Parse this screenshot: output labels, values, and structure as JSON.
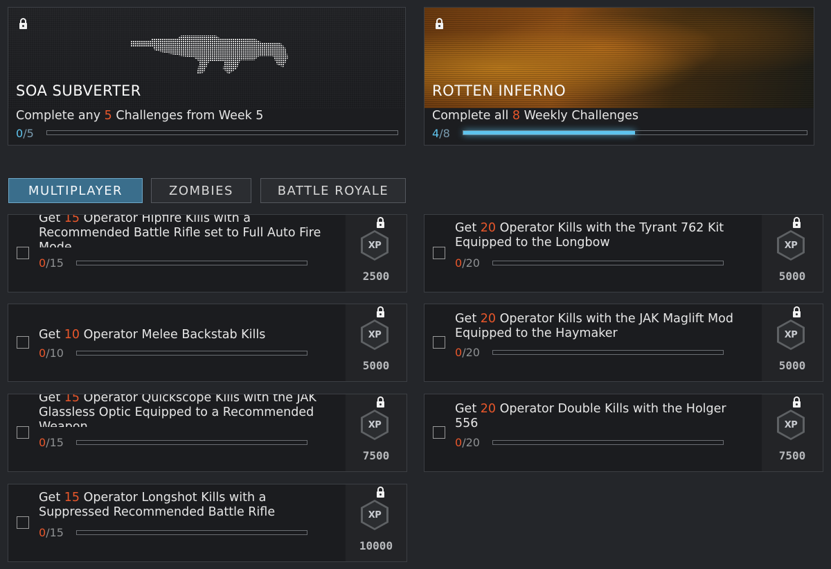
{
  "rewards": [
    {
      "title": "SOA SUBVERTER",
      "desc_pre": "Complete any ",
      "desc_num": "5",
      "desc_post": " Challenges from Week 5",
      "prog_cur": "0",
      "prog_total": "/5",
      "progress": 0.0
    },
    {
      "title": "ROTTEN INFERNO",
      "desc_pre": "Complete all ",
      "desc_num": "8",
      "desc_post": " Weekly Challenges",
      "prog_cur": "4",
      "prog_total": "/8",
      "progress": 0.5
    }
  ],
  "tabs": [
    "MULTIPLAYER",
    "ZOMBIES",
    "BATTLE ROYALE"
  ],
  "challenges": [
    {
      "pre": "Get ",
      "num": "15",
      "post": " Operator Hipfire Kills with a Recommended Battle Rifle set to Full Auto Fire Mode",
      "cur": "0",
      "total": "/15",
      "xp": "2500"
    },
    {
      "pre": "Get ",
      "num": "20",
      "post": " Operator Kills with the Tyrant 762 Kit Equipped to the Longbow",
      "cur": "0",
      "total": "/20",
      "xp": "5000"
    },
    {
      "pre": "Get ",
      "num": "10",
      "post": " Operator Melee Backstab Kills",
      "cur": "0",
      "total": "/10",
      "xp": "5000"
    },
    {
      "pre": "Get ",
      "num": "20",
      "post": " Operator Kills with the JAK Maglift Mod Equipped to the Haymaker",
      "cur": "0",
      "total": "/20",
      "xp": "5000"
    },
    {
      "pre": "Get ",
      "num": "15",
      "post": " Operator Quickscope Kills with the JAK Glassless Optic Equipped to a Recommended Weapon",
      "cur": "0",
      "total": "/15",
      "xp": "7500"
    },
    {
      "pre": "Get ",
      "num": "20",
      "post": " Operator Double Kills with the Holger 556",
      "cur": "0",
      "total": "/20",
      "xp": "7500"
    },
    {
      "pre": "Get ",
      "num": "15",
      "post": " Operator Longshot Kills with a Suppressed Recommended Battle Rifle",
      "cur": "0",
      "total": "/15",
      "xp": "10000"
    }
  ],
  "xp_badge": "XP",
  "colors": {
    "highlight": "#e9572b",
    "progress": "#5ec4ee",
    "tab_active": "#3a6e8c"
  }
}
